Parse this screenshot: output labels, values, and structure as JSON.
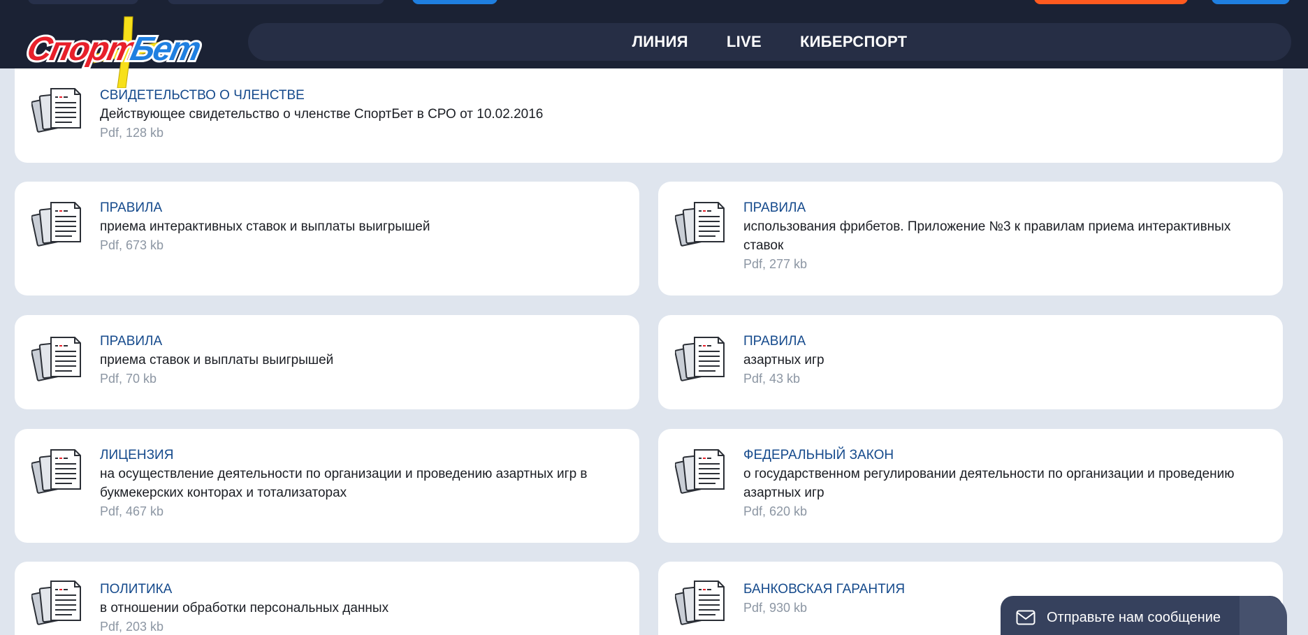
{
  "header": {
    "logo_text": "СпортБет",
    "nav": [
      {
        "label": "ЛИНИЯ"
      },
      {
        "label": "LIVE"
      },
      {
        "label": "КИБЕРСПОРТ"
      }
    ]
  },
  "documents": [
    {
      "title": "СВИДЕТЕЛЬСТВО О ЧЛЕНСТВЕ",
      "desc": "Действующее свидетельство о членстве СпортБет в СРО от 10.02.2016",
      "meta": "Pdf, 128 kb"
    },
    {
      "title": "ПРАВИЛА",
      "desc": "приема интерактивных ставок и выплаты выигрышей",
      "meta": "Pdf, 673 kb"
    },
    {
      "title": "ПРАВИЛА",
      "desc": "использования фрибетов. Приложение №3 к правилам приема интерактивных ставок",
      "meta": "Pdf, 277 kb"
    },
    {
      "title": "ПРАВИЛА",
      "desc": "приема ставок и выплаты выигрышей",
      "meta": "Pdf, 70 kb"
    },
    {
      "title": "ПРАВИЛА",
      "desc": "азартных игр",
      "meta": "Pdf, 43 kb"
    },
    {
      "title": "ЛИЦЕНЗИЯ",
      "desc": "на осуществление деятельности по организации и проведению азартных игр в букмекерских конторах и тотализаторах",
      "meta": "Pdf, 467 kb"
    },
    {
      "title": "ФЕДЕРАЛЬНЫЙ ЗАКОН",
      "desc": "о государственном регулировании деятельности по организации и проведению азартных игр",
      "meta": "Pdf, 620 kb"
    },
    {
      "title": "ПОЛИТИКА",
      "desc": "в отношении обработки персональных данных",
      "meta": "Pdf, 203 kb"
    },
    {
      "title": "БАНКОВСКАЯ ГАРАНТИЯ",
      "desc": "",
      "meta": "Pdf, 930 kb"
    }
  ],
  "chat": {
    "label": "Отправьте нам сообщение"
  },
  "colors": {
    "header_bg": "#1b2234",
    "nav_bg": "#262e45",
    "page_bg": "#dfe5ee",
    "title_blue": "#154a8c",
    "meta_gray": "#8c96a3",
    "accent_orange": "#ff5a1f",
    "accent_blue": "#1f7fe0"
  }
}
